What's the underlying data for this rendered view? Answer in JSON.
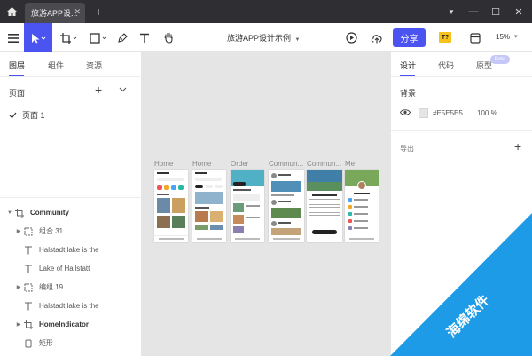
{
  "app": {
    "tab_title": "旅游APP设...",
    "doc_title": "旅游APP设计示例",
    "zoom": "15%",
    "share_label": "分享",
    "t_badge": "T?"
  },
  "left_panel": {
    "tabs": [
      {
        "label": "图层"
      },
      {
        "label": "组件"
      },
      {
        "label": "资源"
      }
    ],
    "pages_title": "页面",
    "pages": [
      {
        "label": "页面 1",
        "selected": true
      }
    ],
    "layers": [
      {
        "label": "Community",
        "kind": "frame"
      },
      {
        "label": "组合 31",
        "kind": "group"
      },
      {
        "label": "Halstadt lake is the",
        "kind": "text"
      },
      {
        "label": "Lake of Hallstatt",
        "kind": "text"
      },
      {
        "label": "编组 19",
        "kind": "group"
      },
      {
        "label": "Halstadt lake is the",
        "kind": "text"
      },
      {
        "label": "HomeIndicator",
        "kind": "frame"
      },
      {
        "label": "矩形",
        "kind": "rect"
      }
    ]
  },
  "canvas": {
    "background": "#E5E5E5",
    "frames": [
      {
        "label": "Home"
      },
      {
        "label": "Home"
      },
      {
        "label": "Order"
      },
      {
        "label": "Commun..."
      },
      {
        "label": "Commun..."
      },
      {
        "label": "Me"
      }
    ]
  },
  "right_panel": {
    "tabs": [
      {
        "label": "设计"
      },
      {
        "label": "代码"
      },
      {
        "label": "原型"
      }
    ],
    "beta": "Beta",
    "background_title": "背景",
    "background_hex": "#E5E5E5",
    "background_opacity": "100 %",
    "export_title": "导出"
  },
  "watermark": {
    "text": "海绵软件"
  },
  "colors": {
    "accent": "#4B53F0",
    "titlebar": "#2F2F33",
    "watermark": "#1E9BE6"
  }
}
